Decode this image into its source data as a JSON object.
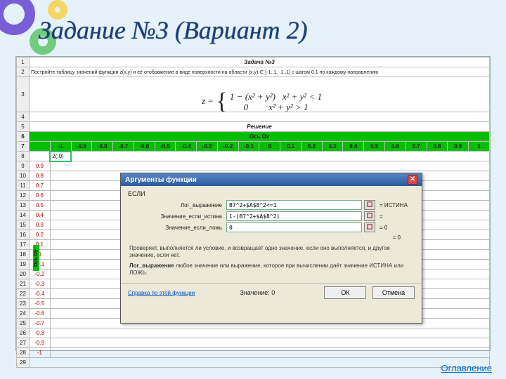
{
  "title": "Задание №3 (Вариант 2)",
  "toc_link": "Оглавление",
  "sheet": {
    "problem_header": "Задача №3",
    "problem_text": "Постройте таблицу значений функции z(x,y) и её отображение в виде поверхности на области (x,y) ∈ [-1..1, -1..1] с шагом 0.1 по каждому направлению",
    "solution_header": "Решение",
    "axis_ox": "Ось Ox",
    "axis_oy": "Ось Oy",
    "col_headers": [
      "-1",
      "-0.9",
      "-0.8",
      "-0.7",
      "-0.6",
      "-0.5",
      "-0.4",
      "-0.3",
      "-0.2",
      "-0.1",
      "0",
      "0.1",
      "0.2",
      "0.3",
      "0.4",
      "0.5",
      "0.6",
      "0.7",
      "0.8",
      "0.9",
      "1"
    ],
    "row_headers": [
      "1",
      "2",
      "3",
      "4",
      "5",
      "6",
      "7",
      "8",
      "9",
      "10",
      "11",
      "12",
      "13",
      "14",
      "15",
      "16",
      "17",
      "18",
      "19",
      "20",
      "21",
      "22",
      "23",
      "24",
      "25",
      "26",
      "27",
      "28",
      "29"
    ],
    "y_values": [
      "0.9",
      "0.8",
      "0.7",
      "0.6",
      "0.5",
      "0.4",
      "0.3",
      "0.2",
      "0.1",
      "0",
      "-0.1",
      "-0.2",
      "-0.3",
      "-0.4",
      "-0.5",
      "-0.6",
      "-0.7",
      "-0.8",
      "-0.9",
      "-1"
    ],
    "cell_b8": "2(;0)"
  },
  "formula": {
    "lhs": "z =",
    "row1_left": "1 − (x² + y²)",
    "row1_right": "x² + y² < 1",
    "row2_left": "0",
    "row2_right": "x² + y² > 1"
  },
  "dialog": {
    "title": "Аргументы функции",
    "fn_name": "ЕСЛИ",
    "labels": {
      "test": "Лог_выражение",
      "then": "Значение_если_истина",
      "else": "Значение_если_ложь"
    },
    "inputs": {
      "test": "B7^2+$A$8^2<=1",
      "then": "1-(B7^2+$A$8^2)",
      "else": "0"
    },
    "previews": {
      "test": "= ИСТИНА",
      "then": "=",
      "else": "= 0"
    },
    "result_line": "= 0",
    "desc1": "Проверяет, выполняется ли условие, и возвращает одно значение, если оно выполняется, и другое значение, если нет.",
    "desc2_label": "Лог_выражение",
    "desc2_text": " любое значение или выражение, которое при вычислении даёт значение ИСТИНА или ЛОЖЬ.",
    "help_link": "Справка по этой функции",
    "value_label": "Значение: 0",
    "ok": "ОК",
    "cancel": "Отмена",
    "close_x": "✕"
  }
}
